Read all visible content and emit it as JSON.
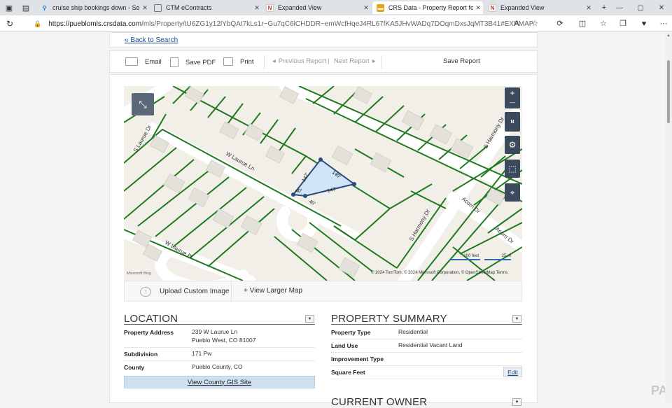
{
  "browser": {
    "tabs": [
      {
        "title": "cruise ship bookings down - Sea",
        "favicon": "search-icon",
        "active": false
      },
      {
        "title": "CTM eContracts",
        "favicon": "doc-icon",
        "active": false
      },
      {
        "title": "Expanded View",
        "favicon": "n-logo-icon",
        "active": false
      },
      {
        "title": "CRS Data - Property Report for P",
        "favicon": "crs-icon",
        "active": true
      },
      {
        "title": "Expanded View",
        "favicon": "n-logo-icon",
        "active": false
      }
    ],
    "new_tab_label": "+",
    "url_host": "https://pueblomls.crsdata.com",
    "url_path": "/mls/Property/tU6ZG1y12lYbQAt7kLs1r~Gu7qC6lCHDDR~emWcfHqeJ4RL67fKA5JHvWADq7DOqmDxsJqMT3B41#EXPMAP"
  },
  "page": {
    "back_link": "« Back to Search",
    "toolbar": {
      "email": "Email",
      "save_pdf": "Save PDF",
      "print": "Print",
      "previous": "Previous Report",
      "divider": "|",
      "next": "Next Report",
      "save_report": "Save Report"
    },
    "map": {
      "street_labels": [
        "S Laurue Dr",
        "W Laurue Ln",
        "W Laurue Pl",
        "S Harmony Dr",
        "S Harmony Dr",
        "Acorn Dr",
        "Acorn Dr"
      ],
      "lot_dims": [
        "147'",
        "140'",
        "147'",
        "40'",
        "40'"
      ],
      "scale_feet": "100 feet",
      "scale_m": "25 m",
      "attribution": "© 2024 TomTom, © 2024 Microsoft Corporation, © OpenStreetMap  Terms",
      "provider": "Microsoft Bing",
      "zoom_in": "+",
      "zoom_out": "—",
      "compass": "N"
    },
    "map_footer": {
      "upload": "Upload Custom Image",
      "larger": "+ View Larger Map"
    },
    "location": {
      "title": "LOCATION",
      "rows": [
        {
          "k": "Property Address",
          "v1": "239 W Laurue Ln",
          "v2": "Pueblo West, CO 81007"
        },
        {
          "k": "Subdivision",
          "v1": "171 Pw"
        },
        {
          "k": "County",
          "v1": "Pueblo County, CO"
        }
      ],
      "gis_button": "View County GIS Site"
    },
    "summary": {
      "title": "PROPERTY SUMMARY",
      "rows": [
        {
          "k": "Property Type",
          "v": "Residential"
        },
        {
          "k": "Land Use",
          "v": "Residential Vacant Land"
        },
        {
          "k": "Improvement Type",
          "v": ""
        },
        {
          "k": "Square Feet",
          "v": ""
        }
      ],
      "edit": "Edit"
    },
    "next_section_title": "CURRENT OWNER",
    "watermark": "PA"
  },
  "colors": {
    "lot_lines": "#1f7a1f",
    "parcel_fill": "#cfe4f7",
    "parcel_stroke": "#2a4a7a",
    "map_bg": "#f2efe9",
    "accent": "#1a4b8c"
  }
}
